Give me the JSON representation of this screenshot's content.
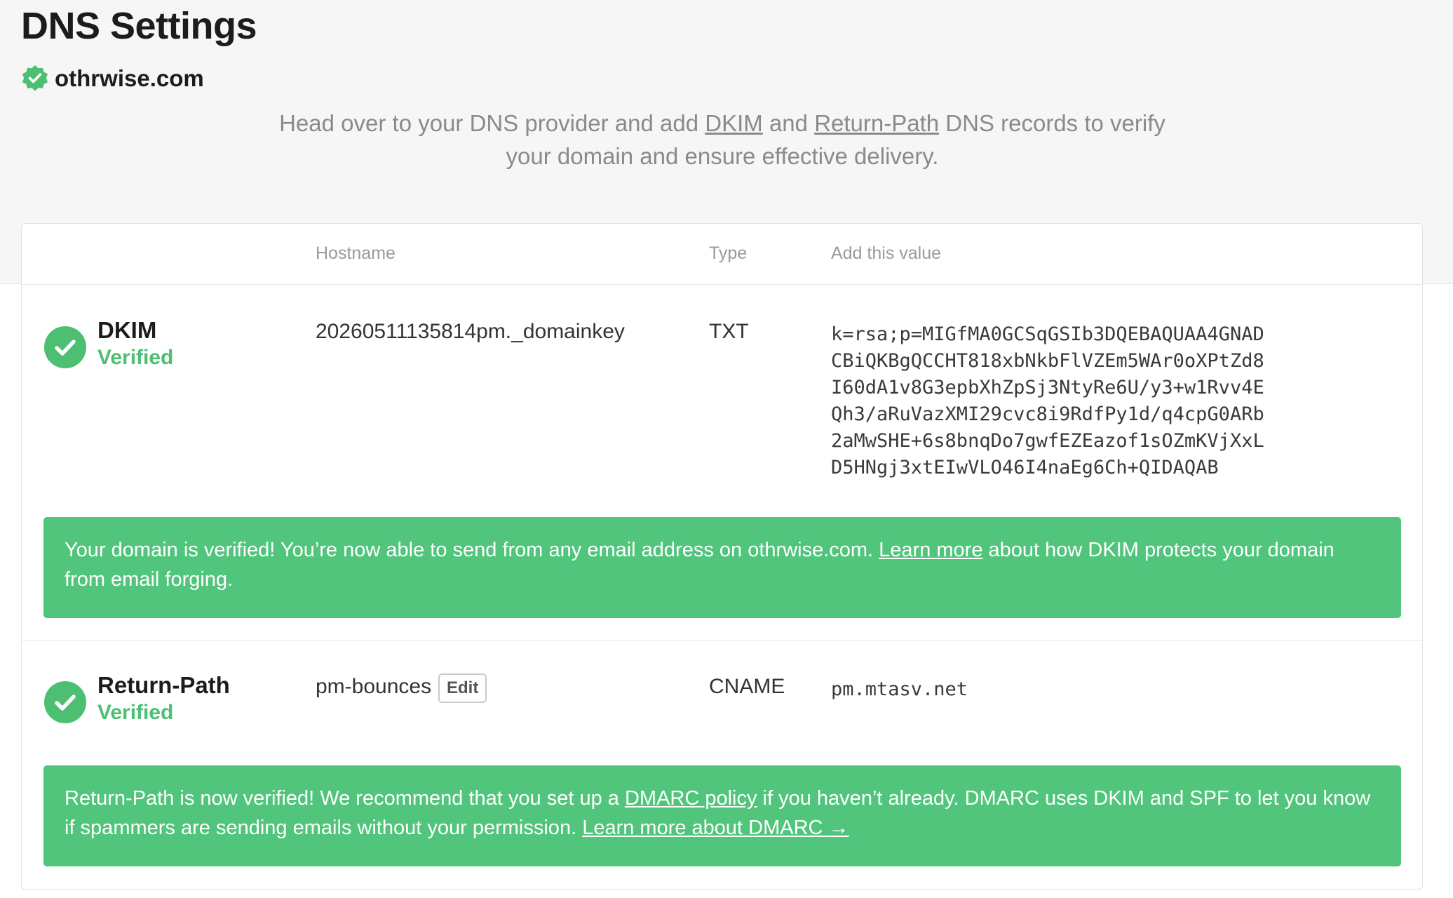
{
  "page": {
    "title": "DNS Settings",
    "domain": "othrwise.com",
    "domain_badge_icon": "verified-badge-icon",
    "intro": {
      "part1": "Head over to your DNS provider and add ",
      "link_dkim": "DKIM",
      "part2": " and ",
      "link_return_path": "Return-Path",
      "part3": " DNS records to verify your domain and ensure effective delivery."
    }
  },
  "table": {
    "headers": {
      "hostname": "Hostname",
      "type": "Type",
      "value": "Add this value"
    }
  },
  "records": {
    "dkim": {
      "name": "DKIM",
      "status": "Verified",
      "hostname": "20260511135814pm._domainkey",
      "type": "TXT",
      "value_lines": [
        "k=rsa;p=MIGfMA0GCSqGSIb3DQEBAQUAA4GNAD",
        "CBiQKBgQCCHT818xbNkbFlVZEm5WAr0oXPtZd8",
        "I60dA1v8G3epbXhZpSj3NtyRe6U/y3+w1Rvv4E",
        "Qh3/aRuVazXMI29cvc8i9RdfPy1d/q4cpG0ARb",
        "2aMwSHE+6s8bnqDo7gwfEZEazof1sOZmKVjXxL",
        "D5HNgj3xtEIwVLO46I4naEg6Ch+QIDAQAB"
      ],
      "banner": {
        "part1": "Your domain is verified! You’re now able to send from any email address on othrwise.com. ",
        "link": "Learn more",
        "part2": " about how DKIM protects your domain from email forging."
      }
    },
    "return_path": {
      "name": "Return-Path",
      "status": "Verified",
      "hostname": "pm-bounces",
      "edit_label": "Edit",
      "type": "CNAME",
      "value": "pm.mtasv.net",
      "banner": {
        "part1": "Return-Path is now verified! We recommend that you set up a ",
        "link_dmarc": "DMARC policy",
        "part2": " if you haven’t already. DMARC uses DKIM and SPF to let you know if spammers are sending emails without your permission. ",
        "link_learn": "Learn more about DMARC →"
      }
    }
  },
  "colors": {
    "verified_green": "#4cbf73",
    "banner_green": "#50c57b",
    "page_band": "#f6f6f6"
  }
}
